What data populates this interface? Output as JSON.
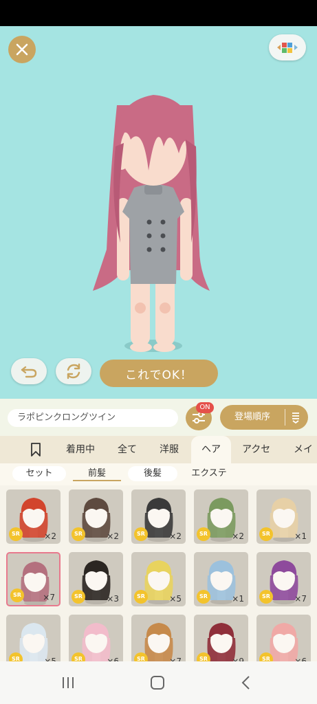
{
  "actions": {
    "ok_label": "これでOK！"
  },
  "item_name": "ラポピンクロングツイン",
  "filter_badge": "ON",
  "sort_label": "登場順序",
  "tabs": [
    "着用中",
    "全て",
    "洋服",
    "ヘア",
    "アクセ",
    "メイ"
  ],
  "subtabs": [
    "セット",
    "前髪",
    "後髪",
    "エクステ"
  ],
  "items": [
    {
      "hair": "#d2452d",
      "rarity": "SR",
      "count": "×2"
    },
    {
      "hair": "#5e4a3f",
      "rarity": "SR",
      "count": "×2"
    },
    {
      "hair": "#3a3a3a",
      "rarity": "SR",
      "count": "×2"
    },
    {
      "hair": "#7b9a5f",
      "rarity": "SR",
      "count": "×2"
    },
    {
      "hair": "#e7d0a6",
      "rarity": "SR",
      "count": "×1"
    },
    {
      "hair": "#b4707e",
      "rarity": "SR",
      "count": "×7"
    },
    {
      "hair": "#2b2622",
      "rarity": "SR",
      "count": "×3"
    },
    {
      "hair": "#e8d35e",
      "rarity": "SR",
      "count": "×5"
    },
    {
      "hair": "#9cc1dd",
      "rarity": "SR",
      "count": "×1"
    },
    {
      "hair": "#8e4a9c",
      "rarity": "SR",
      "count": "×7"
    },
    {
      "hair": "#dbe7ef",
      "rarity": "SR",
      "count": "×5"
    },
    {
      "hair": "#f2bccb",
      "rarity": "SR",
      "count": "×6"
    },
    {
      "hair": "#c68a4b",
      "rarity": "SR",
      "count": "×7"
    },
    {
      "hair": "#8f2f3a",
      "rarity": "SR",
      "count": "×9"
    },
    {
      "hair": "#f0a9a6",
      "rarity": "SR",
      "count": "×6"
    }
  ],
  "selected_item_index": 5,
  "colors": {
    "stage_bg": "#a5e4e2",
    "accent_gold": "#c9a560",
    "badge_red": "#e5504a",
    "rarity_gold": "#f3c32c",
    "selected_border": "#e8798d",
    "avatar_hair": "#c96b85",
    "avatar_outfit": "#9ea2a6"
  },
  "icons": {
    "close": "close-icon",
    "menu": "color-blocks-icon",
    "undo": "undo-arrow-icon",
    "refresh": "refresh-icon",
    "filter": "sliders-icon",
    "sort_toggle": "sort-order-icon",
    "bookmark": "bookmark-icon"
  }
}
